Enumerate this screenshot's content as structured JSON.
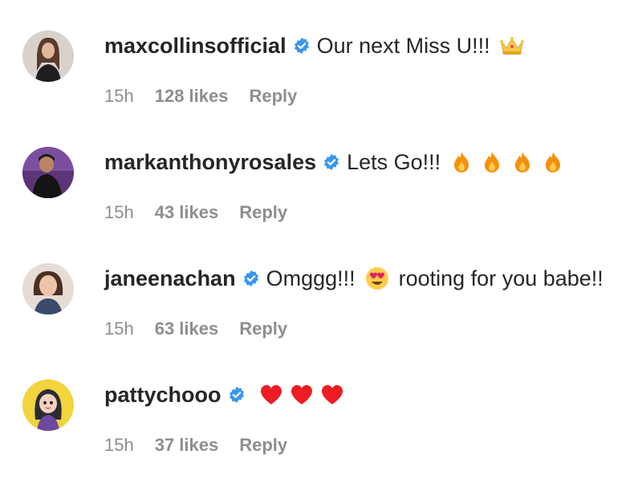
{
  "colors": {
    "username": "#262626",
    "meta": "#8e8e8e",
    "verified": "#3897f0",
    "heart": "#ed1c24",
    "fire": "#f4900c"
  },
  "comments": [
    {
      "username": "maxcollinsofficial",
      "verified": true,
      "text": "Our next Miss U!!!",
      "emojis": [
        "crown-emoji"
      ],
      "time": "15h",
      "likes": "128 likes",
      "reply": "Reply"
    },
    {
      "username": "markanthonyrosales",
      "verified": true,
      "text": "Lets Go!!!",
      "emojis": [
        "fire-emoji",
        "fire-emoji",
        "fire-emoji",
        "fire-emoji"
      ],
      "time": "15h",
      "likes": "43 likes",
      "reply": "Reply"
    },
    {
      "username": "janeenachan",
      "verified": true,
      "text": "Omggg!!!",
      "text2": "rooting for you babe!!",
      "emojis": [
        "heart-eyes-emoji"
      ],
      "time": "15h",
      "likes": "63 likes",
      "reply": "Reply"
    },
    {
      "username": "pattychooo",
      "verified": true,
      "text": "",
      "emojis": [
        "red-heart-emoji",
        "red-heart-emoji",
        "red-heart-emoji"
      ],
      "time": "15h",
      "likes": "37 likes",
      "reply": "Reply"
    }
  ]
}
